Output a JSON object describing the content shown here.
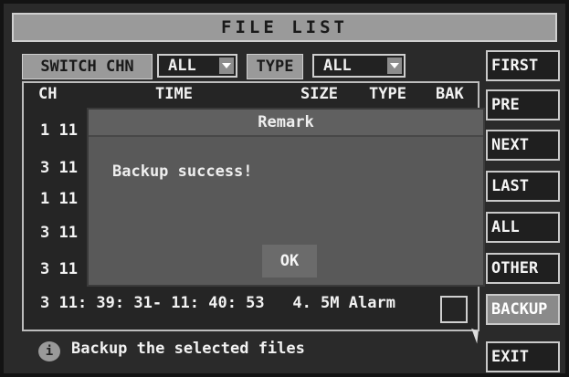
{
  "window": {
    "title": "FILE LIST"
  },
  "filters": {
    "switch_label": "SWITCH CHN",
    "channel_value": "ALL",
    "type_label": "TYPE",
    "type_value": "ALL"
  },
  "table": {
    "headers": {
      "ch": "CH",
      "time": "TIME",
      "size": "SIZE",
      "type": "TYPE",
      "bak": "BAK"
    },
    "rows": [
      "1 11",
      "3 11",
      "1 11",
      "3 11",
      "3 11",
      "3 11: 39: 31- 11: 40: 53   4. 5M Alarm"
    ]
  },
  "side_buttons": [
    "FIRST",
    "PRE",
    "NEXT",
    "LAST",
    "ALL",
    "OTHER",
    "BACKUP",
    "EXIT"
  ],
  "modal": {
    "title": "Remark",
    "message": "Backup success!",
    "ok_label": "OK"
  },
  "status": {
    "icon": "info-icon",
    "text": "Backup the selected files"
  }
}
